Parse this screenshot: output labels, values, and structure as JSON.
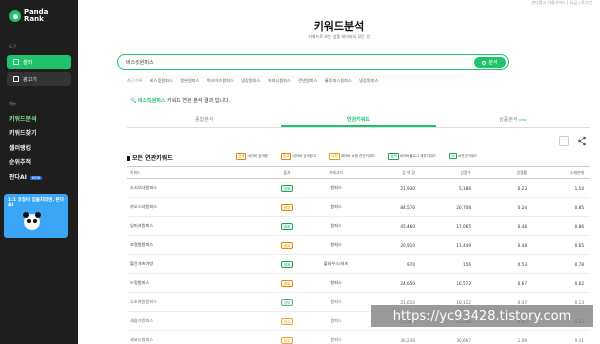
{
  "app": {
    "logo_text_line1": "Panda",
    "logo_text_line2": "Rank"
  },
  "sidebar": {
    "section_tools_label": "도구",
    "tool_buttons": [
      {
        "label": "셀러",
        "active": true
      },
      {
        "label": "광고기",
        "active": false
      }
    ],
    "section_menu_label": "메뉴",
    "menu": [
      {
        "label": "키워드분석",
        "active": true,
        "badge": ""
      },
      {
        "label": "키워드찾기",
        "active": false,
        "badge": ""
      },
      {
        "label": "셀러랭킹",
        "active": false,
        "badge": ""
      },
      {
        "label": "순위추적",
        "active": false,
        "badge": ""
      },
      {
        "label": "판다AI",
        "active": false,
        "badge": "NEW"
      }
    ],
    "promo_text": "1:1 코칭이 있을지라면, 판다AI"
  },
  "header": {
    "top_links": "판다랭크 이용가이드 | 요금 | 로그인",
    "title": "키워드분석",
    "subtitle": "키워드로 보는 상품 데이터의 모든 것"
  },
  "search": {
    "value": "비스킷원피스",
    "button_label": "분석"
  },
  "recent": {
    "label": "최근기록",
    "items": [
      "비스킷원피스",
      "원본원피스",
      "빅사이즈원피스",
      "냉장원피스",
      "저지니원피스",
      "린넨원피스",
      "롱투피스원피스",
      "냉장원피스"
    ]
  },
  "result": {
    "keyword": "비스킷원피스",
    "suffix": "키워드 연관 분석 결과 입니다."
  },
  "tabs": [
    {
      "label": "종합분석",
      "active": false,
      "badge": ""
    },
    {
      "label": "연관키워드",
      "active": true,
      "badge": ""
    },
    {
      "label": "상품분석",
      "active": false,
      "badge": "new"
    }
  ],
  "section": {
    "title": "모든 연관키워드",
    "legend": [
      {
        "tag": "검색",
        "text": "네이버 검색량"
      },
      {
        "tag": "광고",
        "text": "네이버 검색광고"
      },
      {
        "tag": "쇼핑",
        "text": "네이버 쇼핑 연관키워드"
      },
      {
        "tag": "검색",
        "text": "네이버블로그 세부키워드"
      },
      {
        "tag": "AI",
        "text": "AI연관키워드"
      }
    ]
  },
  "table": {
    "headers": [
      "키워드",
      "출처",
      "카테고리",
      "검 색 량",
      "상품수",
      "경쟁률",
      "소재판매"
    ],
    "rows": [
      {
        "keyword": "소시오다원피스",
        "source": "검색",
        "source_color": "green",
        "category": "원피스",
        "volume": "21,930",
        "products": "5,188",
        "ratio": "0.23",
        "sales": "1.54"
      },
      {
        "keyword": "가오스셔원피스",
        "source": "광고",
        "source_color": "orange",
        "category": "원피스",
        "volume": "84,570",
        "products": "20,708",
        "ratio": "0.24",
        "sales": "0.85"
      },
      {
        "keyword": "잉미셔원피스",
        "source": "검색",
        "source_color": "green",
        "category": "원피스",
        "volume": "45,460",
        "products": "17,065",
        "ratio": "0.48",
        "sales": "0.86"
      },
      {
        "keyword": "조명원원피스",
        "source": "광고",
        "source_color": "orange",
        "category": "원피스",
        "volume": "20,910",
        "products": "11,449",
        "ratio": "0.48",
        "sales": "0.65"
      },
      {
        "keyword": "볼간셔츠아방",
        "source": "검색",
        "source_color": "green",
        "category": "블라우스/셔츠",
        "volume": "970",
        "products": "156",
        "ratio": "0.53",
        "sales": "0.78"
      },
      {
        "keyword": "드멋원피스",
        "source": "광고",
        "source_color": "orange",
        "category": "원피스",
        "volume": "24,650",
        "products": "16,572",
        "ratio": "0.67",
        "sales": "0.62"
      },
      {
        "keyword": "오조여원원피스",
        "source": "검색",
        "source_color": "green",
        "category": "원피스",
        "volume": "21,610",
        "products": "10,112",
        "ratio": "0.47",
        "sales": "0.13"
      },
      {
        "keyword": "새슬기원피스",
        "source": "광고",
        "source_color": "orange",
        "category": "원피스",
        "volume": "15,040",
        "products": "10,020",
        "ratio": "0.67",
        "sales": "0.52"
      },
      {
        "keyword": "세코드원피스",
        "source": "광고",
        "source_color": "orange",
        "category": "원피스",
        "volume": "30,230",
        "products": "30,667",
        "ratio": "1.09",
        "sales": "0.11"
      }
    ]
  },
  "watermark": "https://yc93428.tistory.com"
}
